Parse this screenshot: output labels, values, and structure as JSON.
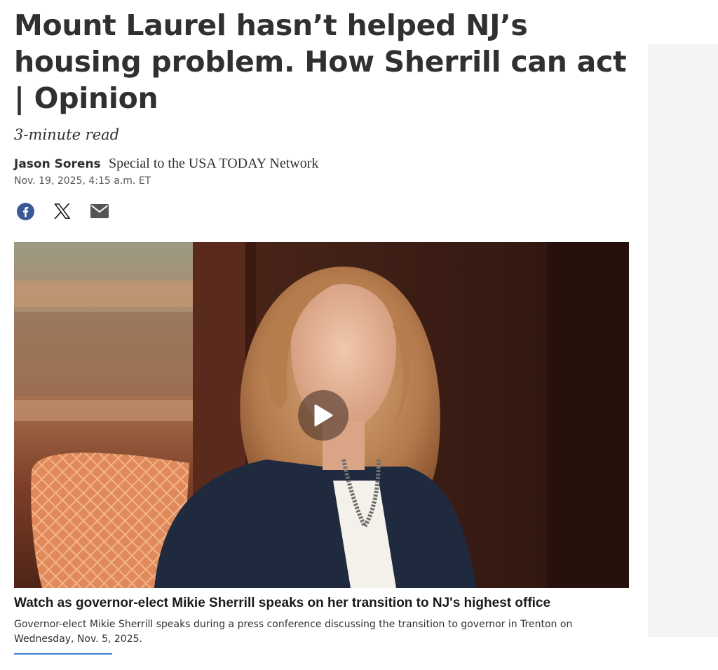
{
  "article": {
    "headline": "Mount Laurel hasn’t helped NJ’s housing problem. How Sherrill can act | Opinion",
    "read_time": "3-minute read",
    "author": "Jason Sorens",
    "affiliation": "Special to the USA TODAY Network",
    "date": "Nov. 19, 2025, 4:15 a.m. ET"
  },
  "share": {
    "items": [
      {
        "icon": "facebook-icon",
        "color": "#3b5998"
      },
      {
        "icon": "x-icon",
        "color": "#111111"
      },
      {
        "icon": "email-icon",
        "color": "#555555"
      }
    ]
  },
  "video": {
    "title": "Watch as governor-elect Mikie Sherrill speaks on her transition to NJ's highest office",
    "caption": "Governor-elect Mikie Sherrill speaks during a press conference discussing the transition to governor in Trenton on Wednesday, Nov. 5, 2025.",
    "play_icon": "play-icon"
  },
  "colors": {
    "accent": "#3f7fd0",
    "text": "#303030"
  }
}
